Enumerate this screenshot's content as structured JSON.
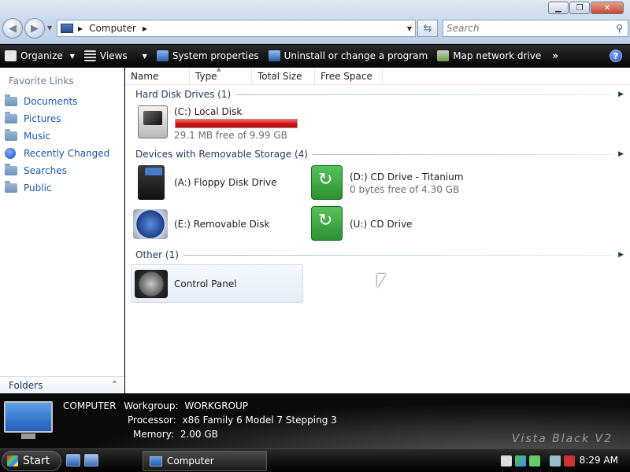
{
  "window": {
    "minimize_label": "▁",
    "maximize_label": "❐",
    "close_label": "✕"
  },
  "address": {
    "location": "Computer"
  },
  "search": {
    "placeholder": "Search"
  },
  "toolbar": {
    "organize": "Organize",
    "views": "Views",
    "system_properties": "System properties",
    "uninstall": "Uninstall or change a program",
    "map_drive": "Map network drive",
    "more": "»",
    "help": "?"
  },
  "nav": {
    "favorite_links": "Favorite Links",
    "items": [
      {
        "label": "Documents",
        "icon": "folder-icon"
      },
      {
        "label": "Pictures",
        "icon": "folder-icon"
      },
      {
        "label": "Music",
        "icon": "folder-icon"
      },
      {
        "label": "Recently Changed",
        "icon": "recent-icon"
      },
      {
        "label": "Searches",
        "icon": "folder-icon"
      },
      {
        "label": "Public",
        "icon": "folder-icon"
      }
    ],
    "folders": "Folders"
  },
  "columns": [
    "Name",
    "Type",
    "Total Size",
    "Free Space"
  ],
  "groups": {
    "hard_disk": "Hard Disk Drives (1)",
    "removable": "Devices with Removable Storage (4)",
    "other": "Other (1)"
  },
  "drives": {
    "c": {
      "label": "(C:) Local Disk",
      "free": "29.1 MB free of 9.99 GB",
      "used_fraction": 0.997,
      "bar_color": "#d11414"
    },
    "a": {
      "label": "(A:) Floppy Disk Drive"
    },
    "d": {
      "label": "(D:) CD Drive - Titanium",
      "free": "0 bytes free of 4.30 GB"
    },
    "e": {
      "label": "(E:) Removable Disk"
    },
    "u": {
      "label": "(U:) CD Drive"
    }
  },
  "other": {
    "control_panel": "Control Panel"
  },
  "details": {
    "name": "COMPUTER",
    "workgroup_key": "Workgroup:",
    "workgroup_val": "WORKGROUP",
    "processor_key": "Processor:",
    "processor_val": "x86 Family 6 Model 7 Stepping 3",
    "memory_key": "Memory:",
    "memory_val": "2.00 GB",
    "watermark": "Vista Black V2"
  },
  "taskbar": {
    "start": "Start",
    "task": "Computer",
    "clock": "8:29 AM"
  }
}
